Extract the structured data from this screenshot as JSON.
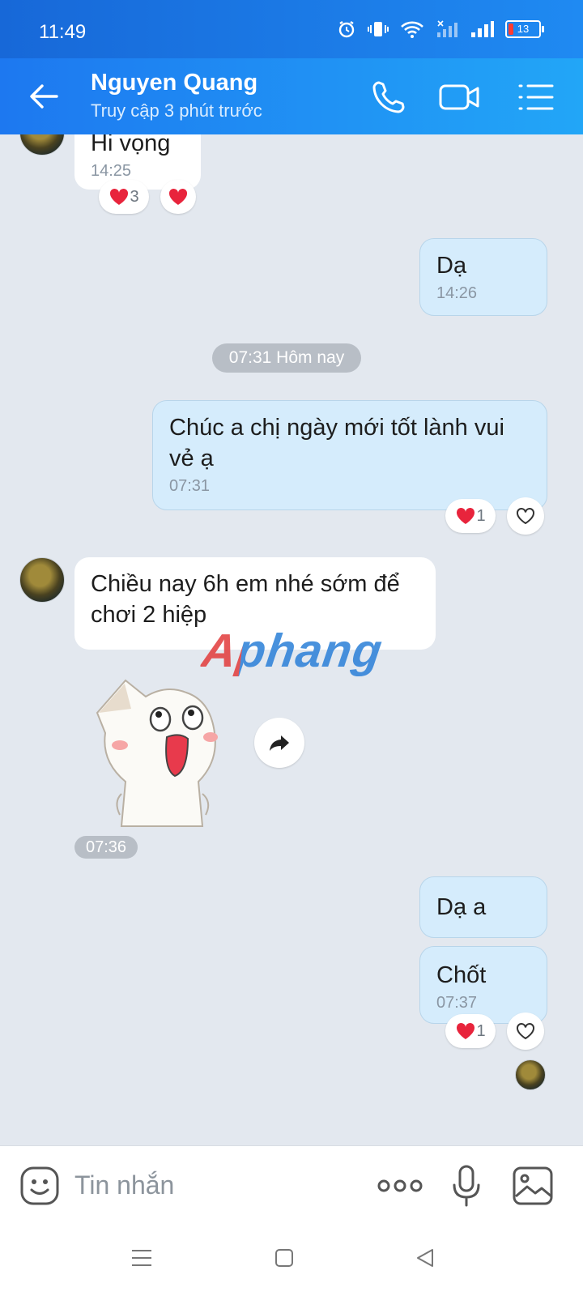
{
  "status_bar": {
    "time": "11:49",
    "battery": "13"
  },
  "header": {
    "contact_name": "Nguyen Quang",
    "contact_status": "Truy cập 3 phút trước"
  },
  "messages": [
    {
      "dir": "in",
      "text": "Hi vọng",
      "time": "14:25",
      "reactions": [
        {
          "emoji": "heart",
          "count": "3"
        },
        {
          "emoji": "heart",
          "count": ""
        }
      ]
    },
    {
      "dir": "out",
      "text": "Dạ",
      "time": "14:26"
    },
    {
      "divider": "07:31 Hôm nay"
    },
    {
      "dir": "out",
      "text": "Chúc a chị ngày mới tốt lành vui vẻ ạ",
      "time": "07:31",
      "reactions": [
        {
          "emoji": "heart",
          "count": "1"
        },
        {
          "emoji": "heart-outline",
          "count": ""
        }
      ]
    },
    {
      "dir": "in",
      "text": "Chiều nay 6h em nhé sớm để chơi 2 hiệp"
    },
    {
      "dir": "in",
      "type": "sticker",
      "time": "07:36"
    },
    {
      "dir": "out",
      "text": "Dạ a"
    },
    {
      "dir": "out",
      "text": "Chốt",
      "time": "07:37",
      "reactions": [
        {
          "emoji": "heart",
          "count": "1"
        },
        {
          "emoji": "heart-outline",
          "count": ""
        }
      ]
    }
  ],
  "watermark": "Aphang",
  "composer": {
    "placeholder": "Tin nhắn"
  },
  "icons": {
    "back": "arrow-left-icon",
    "call": "phone-icon",
    "video": "video-camera-icon",
    "menu": "list-menu-icon",
    "emoji": "emoji-face-icon",
    "more": "more-dots-icon",
    "mic": "microphone-icon",
    "gallery": "image-icon",
    "forward": "forward-arrow-icon"
  },
  "colors": {
    "header_start": "#1d78f0",
    "header_end": "#22a6f7",
    "outgoing_bubble": "#d5ecfc",
    "chat_bg": "#e3e8ef",
    "heart": "#e8243c"
  }
}
